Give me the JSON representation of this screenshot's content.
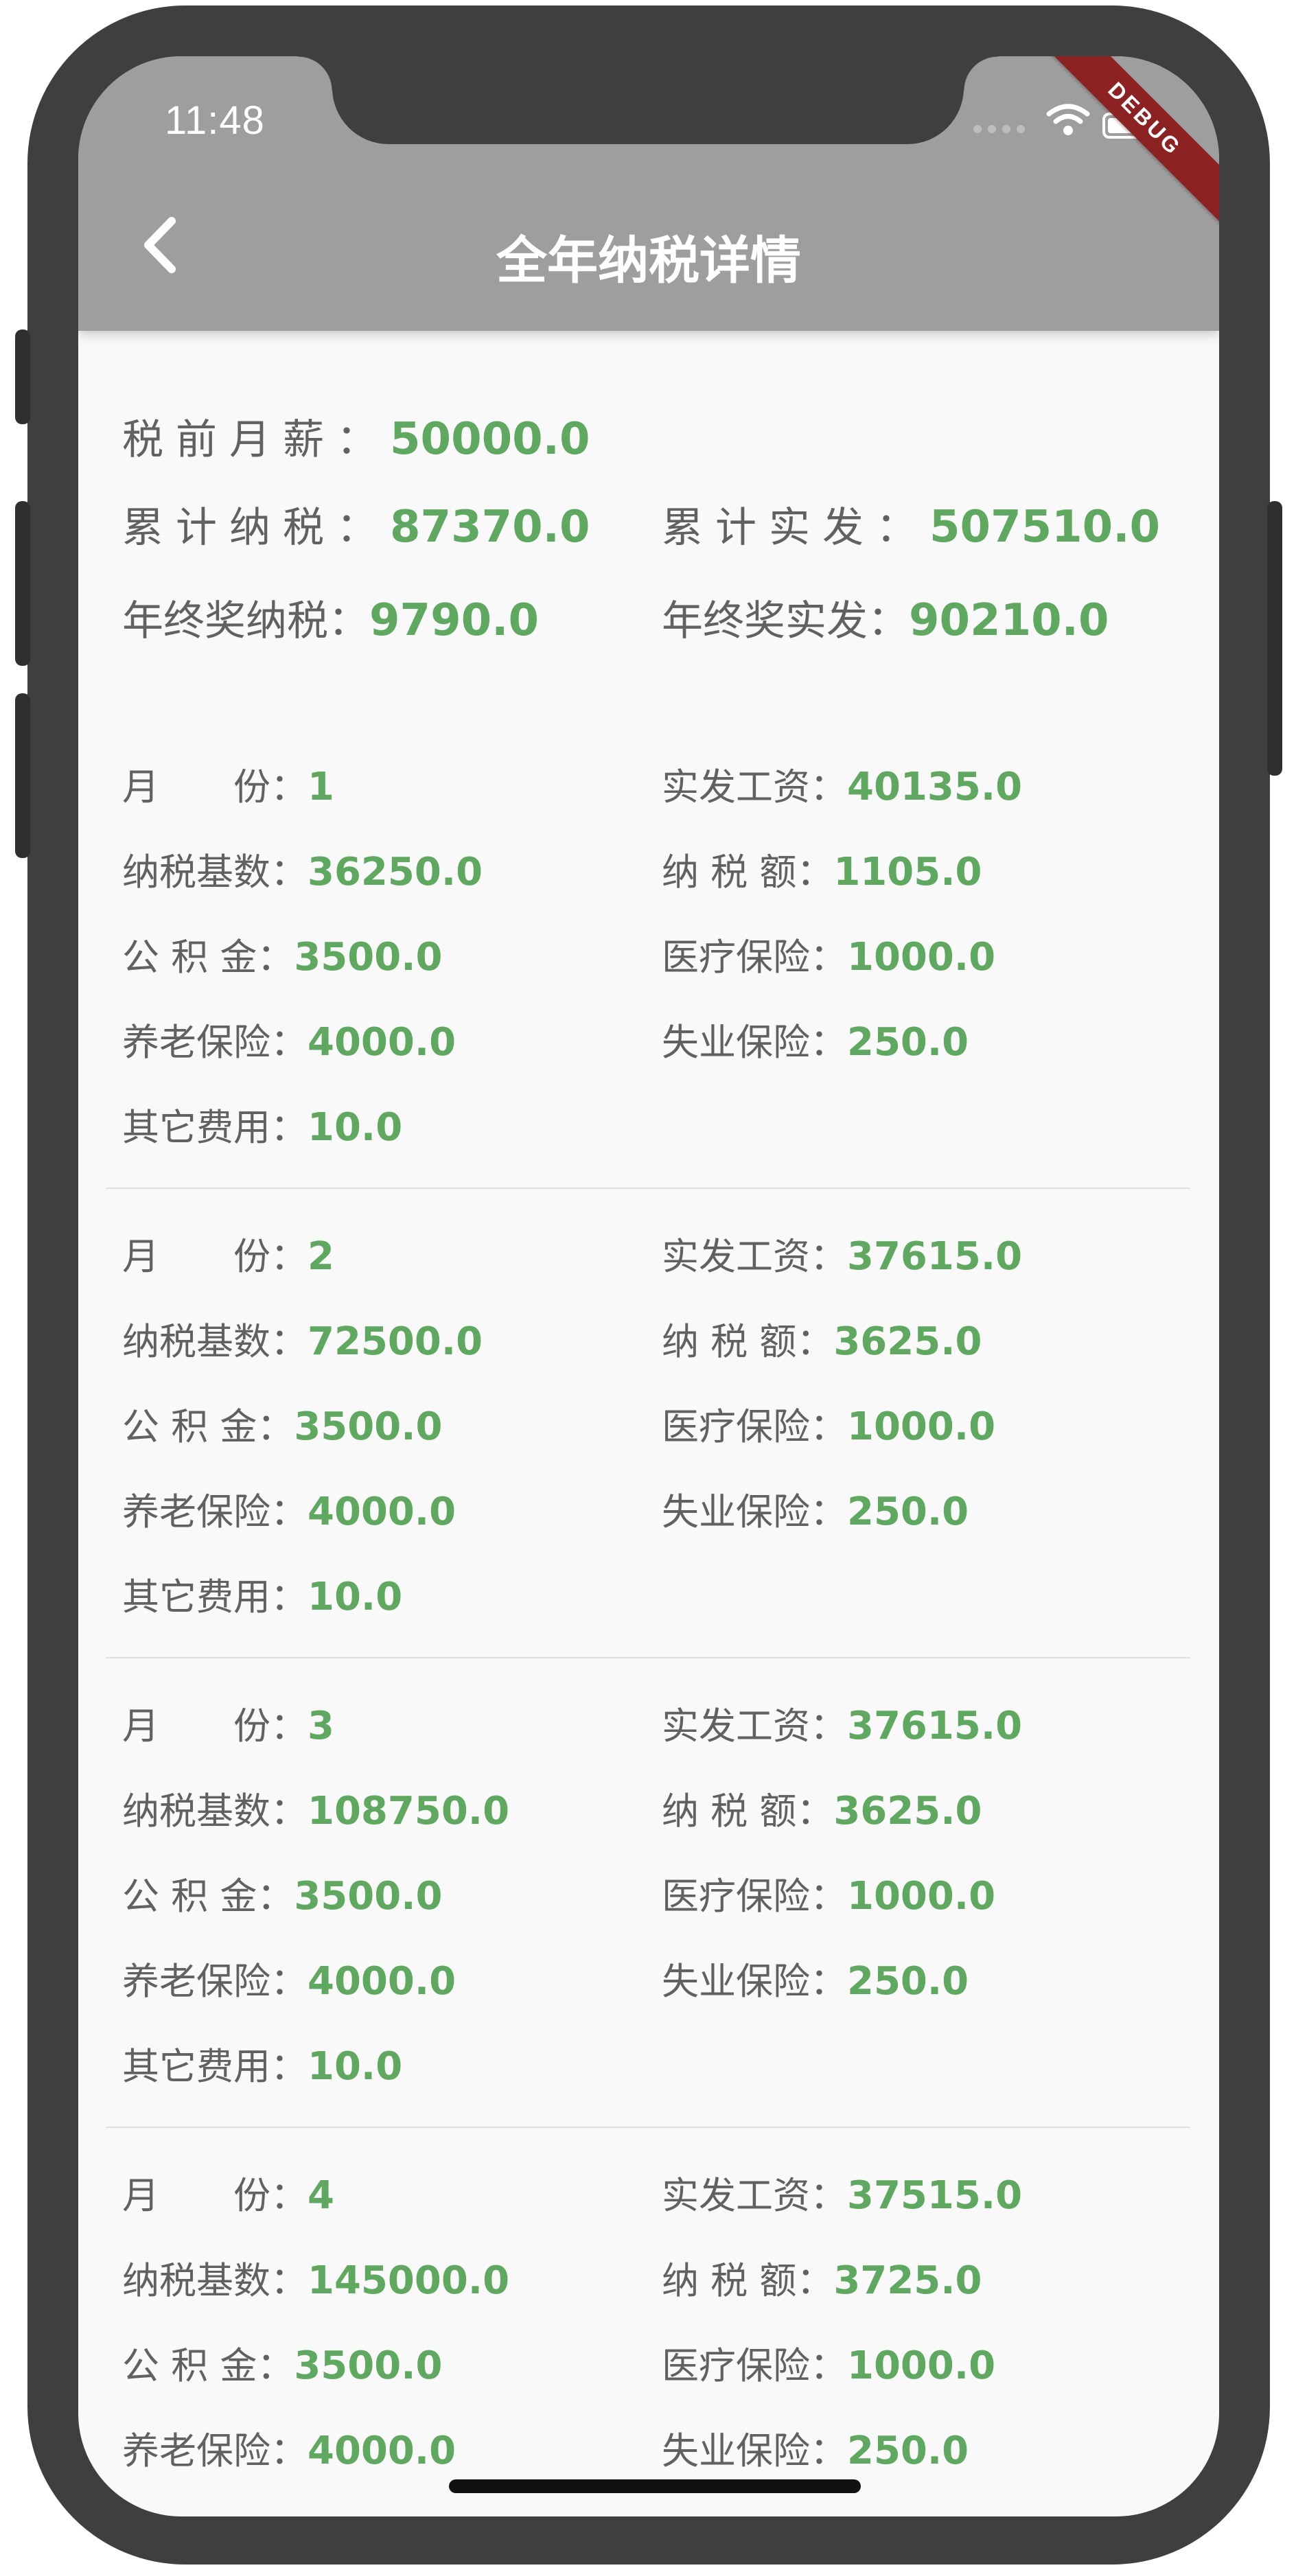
{
  "status_bar": {
    "time": "11:48"
  },
  "debug_banner": "DEBUG",
  "header": {
    "title": "全年纳税详情"
  },
  "summary": {
    "pretax_label": "税前月薪：",
    "pretax_value": "50000.0",
    "total_tax_label": "累计纳税：",
    "total_tax_value": "87370.0",
    "total_net_label": "累计实发：",
    "total_net_value": "507510.0",
    "bonus_tax_label": "年终奖纳税：",
    "bonus_tax_value": "9790.0",
    "bonus_net_label": "年终奖实发：",
    "bonus_net_value": "90210.0"
  },
  "labels": {
    "month": "月　　份：",
    "net_salary": "实发工资：",
    "tax_base": "纳税基数：",
    "tax_amount": "纳 税 额：",
    "housing_fund": "公 积 金：",
    "medical": "医疗保险：",
    "pension": "养老保险：",
    "unemployment": "失业保险：",
    "other": "其它费用："
  },
  "months": [
    {
      "month": "1",
      "net_salary": "40135.0",
      "tax_base": "36250.0",
      "tax_amount": "1105.0",
      "housing_fund": "3500.0",
      "medical": "1000.0",
      "pension": "4000.0",
      "unemployment": "250.0",
      "other": "10.0"
    },
    {
      "month": "2",
      "net_salary": "37615.0",
      "tax_base": "72500.0",
      "tax_amount": "3625.0",
      "housing_fund": "3500.0",
      "medical": "1000.0",
      "pension": "4000.0",
      "unemployment": "250.0",
      "other": "10.0"
    },
    {
      "month": "3",
      "net_salary": "37615.0",
      "tax_base": "108750.0",
      "tax_amount": "3625.0",
      "housing_fund": "3500.0",
      "medical": "1000.0",
      "pension": "4000.0",
      "unemployment": "250.0",
      "other": "10.0"
    },
    {
      "month": "4",
      "net_salary": "37515.0",
      "tax_base": "145000.0",
      "tax_amount": "3725.0",
      "housing_fund": "3500.0",
      "medical": "1000.0",
      "pension": "4000.0",
      "unemployment": "250.0"
    }
  ],
  "colors": {
    "value_green": "#5fa85f",
    "appbar_grey": "#9e9e9e",
    "label_grey": "#616161"
  }
}
